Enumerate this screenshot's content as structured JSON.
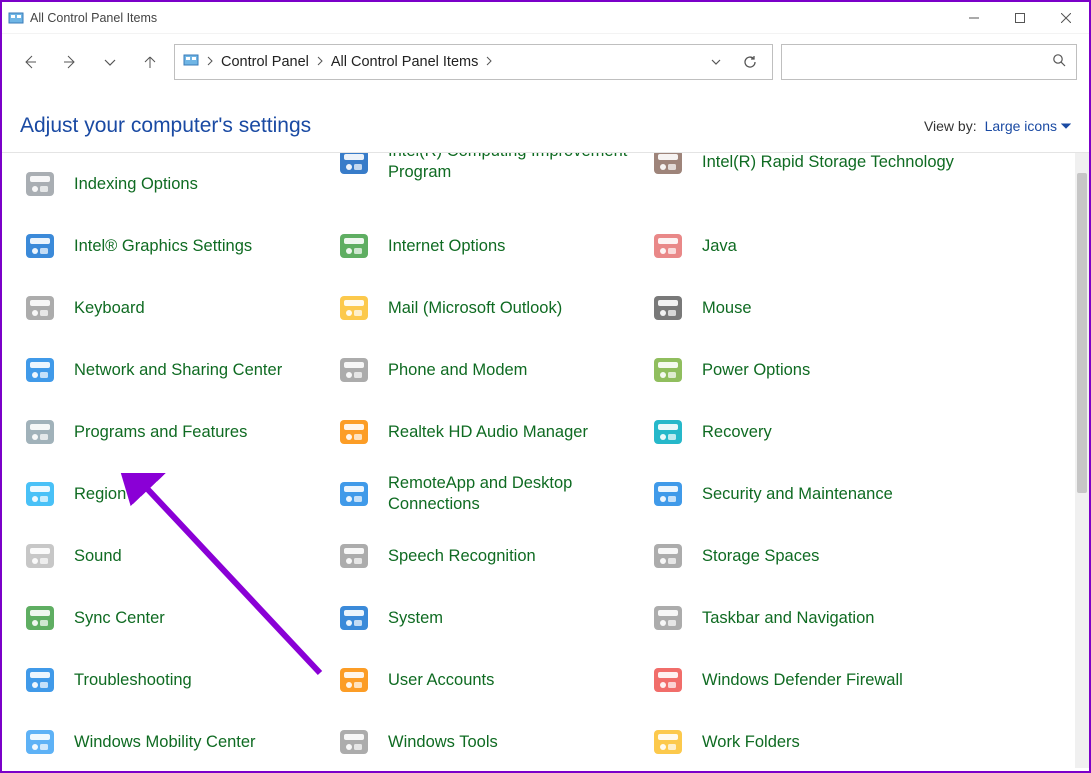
{
  "window": {
    "title": "All Control Panel Items"
  },
  "address": {
    "crumb1": "Control Panel",
    "crumb2": "All Control Panel Items"
  },
  "header": {
    "title": "Adjust your computer's settings",
    "viewby_label": "View by:",
    "viewby_value": "Large icons"
  },
  "items": {
    "c1": [
      {
        "label": "Indexing Options",
        "name": "indexing-options",
        "ic": "#9aa0a6"
      },
      {
        "label": "Intel® Graphics Settings",
        "name": "intel-graphics-settings",
        "ic": "#1976d2"
      },
      {
        "label": "Keyboard",
        "name": "keyboard",
        "ic": "#9e9e9e"
      },
      {
        "label": "Network and Sharing Center",
        "name": "network-and-sharing-center",
        "ic": "#1e88e5"
      },
      {
        "label": "Programs and Features",
        "name": "programs-and-features",
        "ic": "#90a4ae"
      },
      {
        "label": "Region",
        "name": "region",
        "ic": "#29b6f6"
      },
      {
        "label": "Sound",
        "name": "sound",
        "ic": "#bdbdbd"
      },
      {
        "label": "Sync Center",
        "name": "sync-center",
        "ic": "#43a047"
      },
      {
        "label": "Troubleshooting",
        "name": "troubleshooting",
        "ic": "#1e88e5"
      },
      {
        "label": "Windows Mobility Center",
        "name": "windows-mobility-center",
        "ic": "#42a5f5"
      }
    ],
    "c2": [
      {
        "label": "Intel(R) Computing Improvement Program",
        "name": "intel-computing-improvement-program",
        "ic": "#1565c0",
        "cut": true
      },
      {
        "label": "Internet Options",
        "name": "internet-options",
        "ic": "#43a047"
      },
      {
        "label": "Mail (Microsoft Outlook)",
        "name": "mail-microsoft-outlook",
        "ic": "#fbc02d"
      },
      {
        "label": "Phone and Modem",
        "name": "phone-and-modem",
        "ic": "#9e9e9e"
      },
      {
        "label": "Realtek HD Audio Manager",
        "name": "realtek-hd-audio-manager",
        "ic": "#fb8c00"
      },
      {
        "label": "RemoteApp and Desktop Connections",
        "name": "remoteapp-and-desktop-connections",
        "ic": "#1e88e5"
      },
      {
        "label": "Speech Recognition",
        "name": "speech-recognition",
        "ic": "#9e9e9e"
      },
      {
        "label": "System",
        "name": "system",
        "ic": "#1976d2"
      },
      {
        "label": "User Accounts",
        "name": "user-accounts",
        "ic": "#fb8c00"
      },
      {
        "label": "Windows Tools",
        "name": "windows-tools",
        "ic": "#9e9e9e"
      }
    ],
    "c3": [
      {
        "label": "Intel(R) Rapid Storage Technology",
        "name": "intel-rapid-storage-technology",
        "ic": "#8d6e63",
        "cut": true
      },
      {
        "label": "Java",
        "name": "java",
        "ic": "#e57373"
      },
      {
        "label": "Mouse",
        "name": "mouse",
        "ic": "#616161"
      },
      {
        "label": "Power Options",
        "name": "power-options",
        "ic": "#7cb342"
      },
      {
        "label": "Recovery",
        "name": "recovery",
        "ic": "#00acc1"
      },
      {
        "label": "Security and Maintenance",
        "name": "security-and-maintenance",
        "ic": "#1e88e5"
      },
      {
        "label": "Storage Spaces",
        "name": "storage-spaces",
        "ic": "#9e9e9e"
      },
      {
        "label": "Taskbar and Navigation",
        "name": "taskbar-and-navigation",
        "ic": "#9e9e9e"
      },
      {
        "label": "Windows Defender Firewall",
        "name": "windows-defender-firewall",
        "ic": "#ef5350"
      },
      {
        "label": "Work Folders",
        "name": "work-folders",
        "ic": "#fbc02d"
      }
    ]
  }
}
